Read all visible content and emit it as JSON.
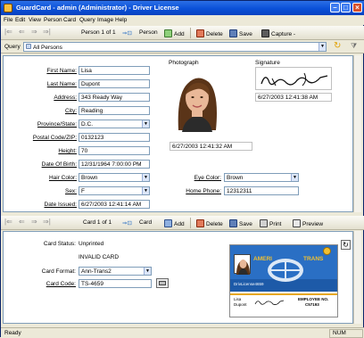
{
  "window": {
    "title": "GuardCard - admin (Administrator) - Driver License"
  },
  "menu": [
    "File",
    "Edit",
    "View",
    "Person",
    "Card",
    "Query",
    "Image",
    "Help"
  ],
  "person_toolbar": {
    "position": "Person 1 of 1",
    "label": "Person",
    "add": "Add",
    "delete": "Delete",
    "save": "Save",
    "capture": "Capture -"
  },
  "query": {
    "label": "Query",
    "value": "All Persons"
  },
  "person": {
    "first_name_label": "First Name:",
    "first_name": "Lisa",
    "last_name_label": "Last Name:",
    "last_name": "Dupont",
    "address_label": "Address:",
    "address": "343 Ready Way",
    "city_label": "City:",
    "city": "Reading",
    "province_label": "Province/State:",
    "province": "D.C.",
    "postal_label": "Postal Code/ZIP:",
    "postal": "0132123",
    "height_label": "Height:",
    "height": "70",
    "dob_label": "Date Of Birth:",
    "dob": "12/31/1964 7:00:00 PM",
    "hair_label": "Hair Color:",
    "hair": "Brown",
    "sex_label": "Sex:",
    "sex": "F",
    "issued_label": "Date Issued:",
    "issued": "6/27/2003 12:41:14 AM",
    "eye_label": "Eye Color:",
    "eye": "Brown",
    "phone_label": "Home Phone:",
    "phone": "12312311",
    "photo_label": "Photograph",
    "photo_date": "6/27/2003 12:41:32 AM",
    "signature_label": "Signature",
    "signature_date": "6/27/2003 12:41:38 AM"
  },
  "card_toolbar": {
    "position": "Card 1 of 1",
    "label": "Card",
    "add": "Add",
    "delete": "Delete",
    "save": "Save",
    "print": "Print",
    "preview": "Preview"
  },
  "card": {
    "status_label": "Card Status:",
    "status": "Unprinted",
    "invalid": "INVALID CARD",
    "format_label": "Card Format:",
    "format": "Ann-Trans2",
    "code_label": "Card Code:",
    "code": "TS-4659",
    "preview": {
      "brand_left": "AMERI",
      "brand_right": "TRANS",
      "id_text": "DrivLicense4659",
      "name_first": "Lisa",
      "name_last": "Dupont",
      "emp_label": "EMPLOYEE NO.",
      "emp_no": "C57193"
    }
  },
  "status": {
    "left": "Ready",
    "num": "NUM"
  },
  "colors": {
    "title_bar": "#0a50d8",
    "card_blue": "#2a6fc4",
    "card_gold": "#e8a820"
  }
}
